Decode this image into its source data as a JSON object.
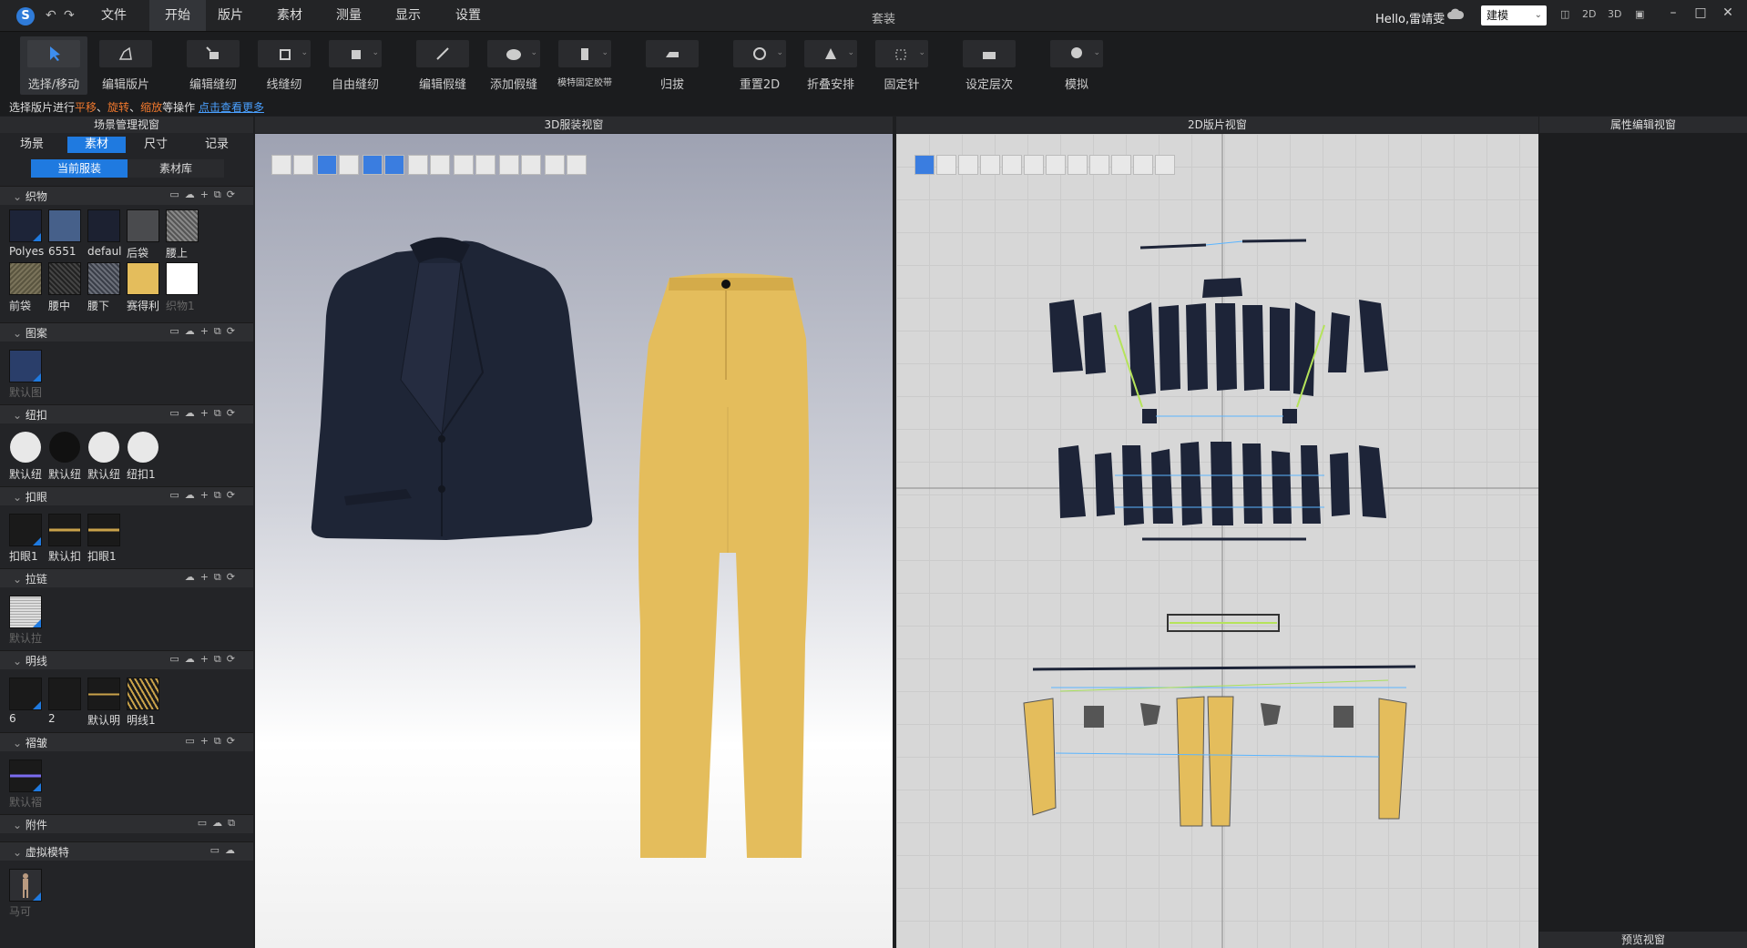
{
  "titlebar": {
    "menus": [
      "文件",
      "开始",
      "版片",
      "素材",
      "测量",
      "显示",
      "设置"
    ],
    "active_menu": "开始",
    "app_title": "套装",
    "greeting": "Hello,雷靖雯",
    "mode": "建模",
    "view_modes": [
      "2D",
      "3D"
    ]
  },
  "toolbar": {
    "tools": [
      "选择/移动",
      "编辑版片",
      "编辑缝纫",
      "线缝纫",
      "自由缝纫",
      "编辑假缝",
      "添加假缝",
      "模特固定胶带",
      "归拔",
      "重置2D",
      "折叠安排",
      "固定针",
      "设定层次",
      "模拟"
    ]
  },
  "hint": {
    "prefix": "选择版片进行",
    "op1": "平移",
    "sep1": "、",
    "op2": "旋转",
    "sep2": "、",
    "op3": "缩放",
    "suffix": "等操作",
    "link": "点击查看更多"
  },
  "left": {
    "title": "场景管理视窗",
    "tabs": [
      "场景",
      "素材",
      "尺寸",
      "记录"
    ],
    "subtabs": [
      "当前服装",
      "素材库"
    ],
    "sections": {
      "fabric": {
        "title": "织物",
        "items": [
          "Polyes",
          "6551",
          "defaul",
          "后袋",
          "腰上",
          "前袋",
          "腰中",
          "腰下",
          "赛得利",
          "织物1"
        ]
      },
      "pattern": {
        "title": "图案",
        "items": [
          "默认图"
        ]
      },
      "button": {
        "title": "纽扣",
        "items": [
          "默认纽",
          "默认纽",
          "默认纽",
          "纽扣1"
        ]
      },
      "buttonhole": {
        "title": "扣眼",
        "items": [
          "扣眼1",
          "默认扣",
          "扣眼1"
        ]
      },
      "zipper": {
        "title": "拉链",
        "items": [
          "默认拉"
        ]
      },
      "topstitch": {
        "title": "明线",
        "items": [
          "6",
          "2",
          "默认明",
          "明线1"
        ]
      },
      "pleat": {
        "title": "褶皱",
        "items": [
          "默认褶"
        ]
      },
      "accessory": {
        "title": "附件"
      },
      "avatar": {
        "title": "虚拟模特",
        "items": [
          "马可"
        ]
      }
    }
  },
  "view3d": {
    "title": "3D服装视窗"
  },
  "view2d": {
    "title": "2D版片视窗"
  },
  "right": {
    "title": "属性编辑视窗",
    "preview": "预览视窗"
  },
  "colors": {
    "accent": "#1f7ae0",
    "navy": "#1d2438",
    "mustard": "#e4bd5c",
    "hint_orange": "#f0782d"
  }
}
